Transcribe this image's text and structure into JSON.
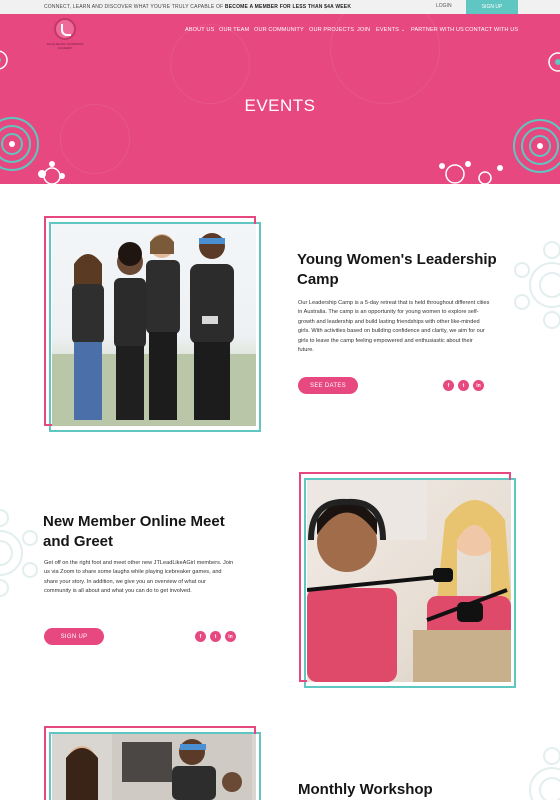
{
  "topbar": {
    "tagline_start": "CONNECT, LEARN AND DISCOVER WHAT YOU'RE TRULY CAPABLE OF",
    "tagline_bold": "BECOME A MEMBER FOR LESS THAN $4A WEEK",
    "login_label": "LOGIN",
    "signup_label": "SIGN UP"
  },
  "logo": {
    "wordmark": "JACQUELINE THOMPSON ACADEMY"
  },
  "nav": {
    "items": [
      {
        "label": "ABOUT US"
      },
      {
        "label": "OUR TEAM"
      },
      {
        "label": "OUR COMMUNITY"
      },
      {
        "label": "OUR PROJECTS"
      },
      {
        "label": "JOIN"
      },
      {
        "label": "EVENTS"
      },
      {
        "label": "PARTNER WITH US"
      },
      {
        "label": "CONTACT WITH US"
      }
    ]
  },
  "hero": {
    "title": "EVENTS"
  },
  "events": [
    {
      "title_line1": "Young Women's Leadership",
      "title_line2": "Camp",
      "body": "Our Leadership Camp is a 5-day retreat that is held throughout different cities in Australia. The camp is an opportunity for young women to explore self-growth and leadership and build lasting friendships with other like-minded girls. With activities based on building confidence and clarity, we aim for our girls to leave the camp feeling empowered and enthusiastic about their future.",
      "cta": "SEE DATES"
    },
    {
      "title_line1": "New Member Online Meet",
      "title_line2": "and Greet",
      "body": "Get off on the right foot and meet other new JTLeadLikeAGirl members. Join us via Zoom to share some laughs while playing icebreaker games, and share your story. In addition, we give you an overview of what our community is all about and what you can do to get involved.",
      "cta": "SIGN UP"
    },
    {
      "title_line1": "Monthly Workshop",
      "title_line2": ""
    }
  ],
  "social": {
    "facebook": "f",
    "twitter": "t",
    "linkedin": "in"
  },
  "colors": {
    "brand_pink": "#e6487f",
    "accent_teal": "#5fc6c1"
  }
}
